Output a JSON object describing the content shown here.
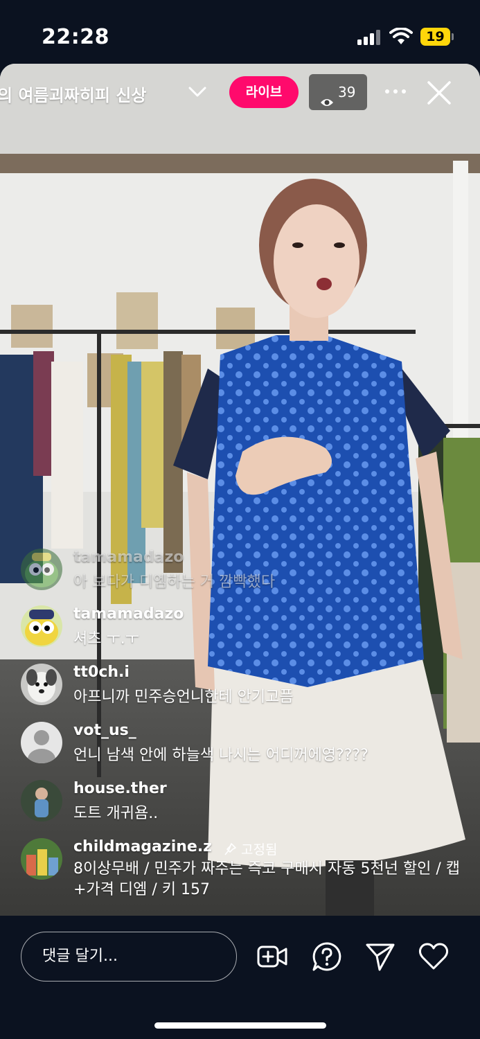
{
  "status_bar": {
    "time": "22:28",
    "battery_level": "19",
    "battery_color": "#ffd60a"
  },
  "live": {
    "title": "의 여름괴짜히피  신상",
    "live_label": "라이브",
    "live_color": "#ff0a6c",
    "viewer_count": "39",
    "icons": [
      "chevron-down-icon",
      "eye-icon",
      "more-icon",
      "close-icon"
    ]
  },
  "comments": [
    {
      "user": "tamamadazo",
      "text": "아 보다가 디엠하는 거 깜빡했다",
      "avatar": "keroro-avatar",
      "faded": true
    },
    {
      "user": "tamamadazo",
      "text": "셔츠 ㅜ.ㅜ",
      "avatar": "keroro-avatar"
    },
    {
      "user": "tt0ch.i",
      "text": "아프니까 민주승언니한테 안기고픔",
      "avatar": "dog-avatar"
    },
    {
      "user": "vot_us_",
      "text": "언니 남색 안에 하늘색 나시는 어디꺼에영????",
      "avatar": "default-avatar"
    },
    {
      "user": "house.ther",
      "text": "도트 개귀욤..",
      "avatar": "person-avatar"
    },
    {
      "user": "childmagazine.z",
      "pinned_label": "고정됨",
      "text": "8이상무배 / 민주가 짜주는 즉코 구매시 자동 5천넌 할인 / 캡+가격 디엠 / 키 157",
      "avatar": "shop-avatar"
    }
  ],
  "bottom_bar": {
    "input_placeholder": "댓글 달기...",
    "icons": [
      "add-video-icon",
      "question-icon",
      "send-icon",
      "heart-icon"
    ]
  }
}
